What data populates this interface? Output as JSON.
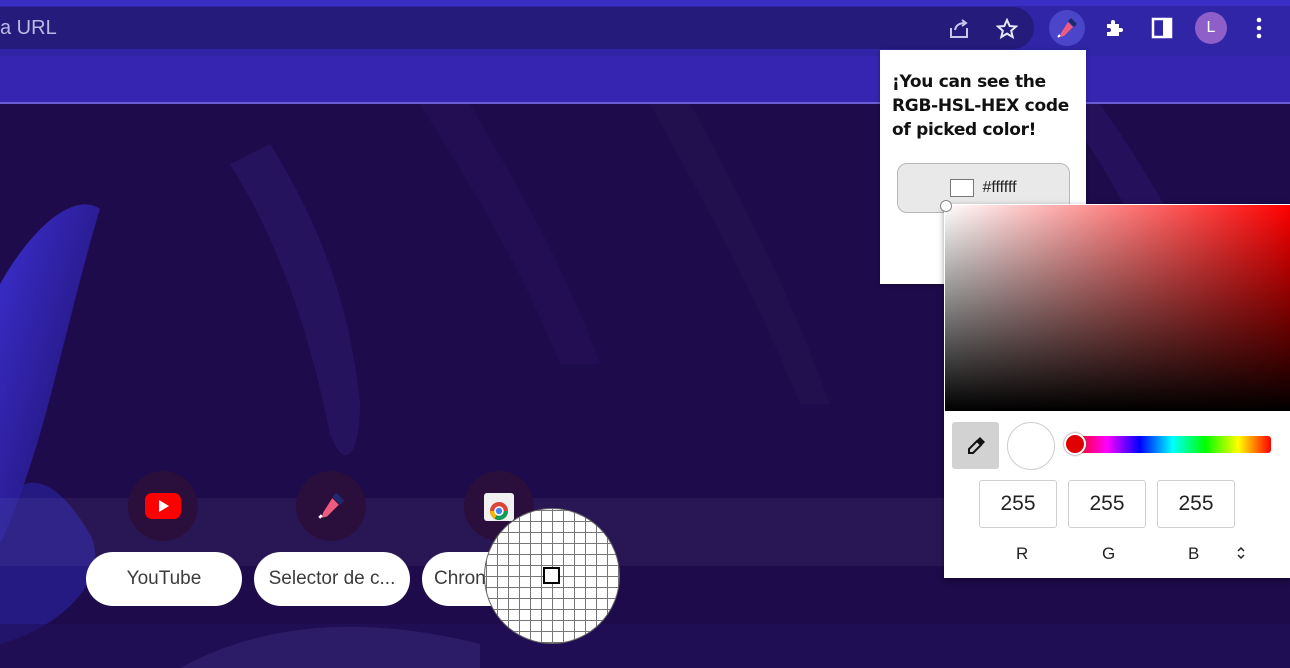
{
  "toolbar": {
    "omnibox_text": "a URL",
    "share_icon": "share-icon",
    "star_icon": "star-icon",
    "extension_icon": "color-picker-extension-icon",
    "puzzle_icon": "puzzle-icon",
    "sidepanel_icon": "side-panel-icon",
    "avatar_letter": "L",
    "menu_icon": "kebab-menu-icon"
  },
  "shortcuts": [
    {
      "label": "YouTube",
      "icon": "youtube-icon"
    },
    {
      "label": "Selector de c...",
      "icon": "color-picker-icon"
    },
    {
      "label": "Chron",
      "icon": "chrome-webstore-icon"
    }
  ],
  "popup": {
    "title": "¡You can see the RGB-HSL-HEX code of picked color!",
    "hex": "#ffffff",
    "swatch_color": "#ffffff"
  },
  "picker": {
    "hue_color": "#ff0000",
    "r": "255",
    "g": "255",
    "b": "255",
    "r_label": "R",
    "g_label": "G",
    "b_label": "B",
    "mode_toggle": "⌃⌄"
  },
  "colors": {
    "toolbar_bg": "#2f25a6",
    "page_bg": "#1c0a4a"
  }
}
